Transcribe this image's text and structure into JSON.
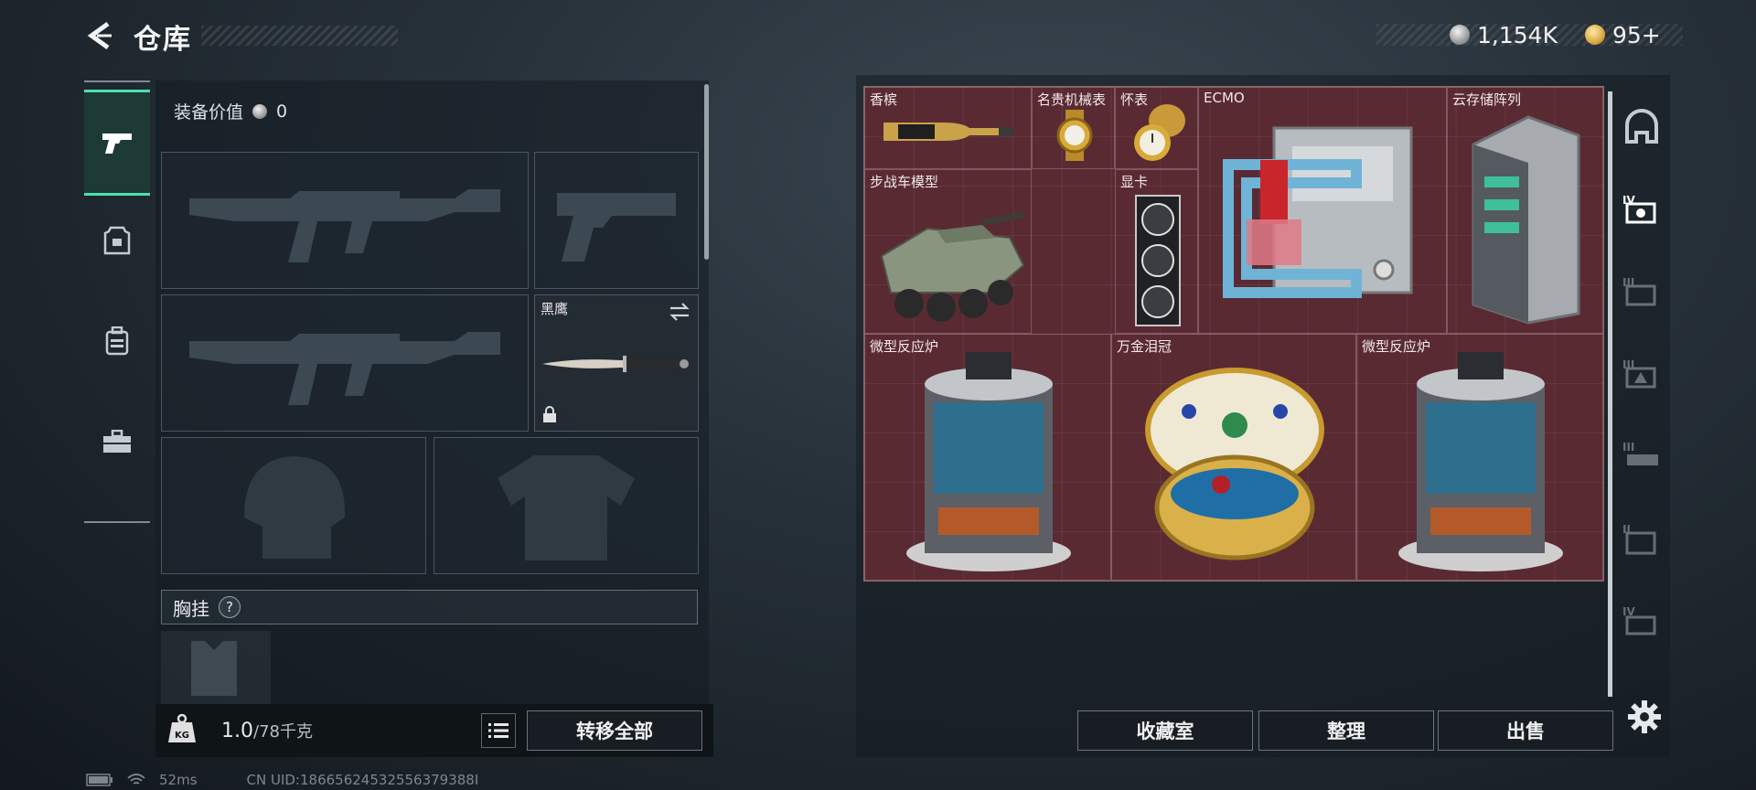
{
  "header": {
    "title": "仓库",
    "currencies": [
      {
        "icon": "silver-coin-icon",
        "value": "1,154K"
      },
      {
        "icon": "gold-coin-icon",
        "value": "95+"
      }
    ]
  },
  "categories": [
    {
      "name": "weapons",
      "icon": "pistol-icon",
      "active": true
    },
    {
      "name": "armor",
      "icon": "armor-vest-icon",
      "active": false
    },
    {
      "name": "backpack",
      "icon": "backpack-icon",
      "active": false
    },
    {
      "name": "toolbox",
      "icon": "toolbox-icon",
      "active": false
    }
  ],
  "equipment": {
    "value_label": "装备价值",
    "value": "0",
    "knife_label": "黑鹰",
    "chest_rig_label": "胸挂",
    "help": "?"
  },
  "footer": {
    "weight_icon_text": "KG",
    "weight_current": "1.0",
    "weight_max": "/78千克",
    "transfer_all": "转移全部"
  },
  "storage": {
    "items": [
      {
        "label": "香槟",
        "icon": "champagne-icon"
      },
      {
        "label": "名贵机械表",
        "icon": "watch-icon"
      },
      {
        "label": "怀表",
        "icon": "pocket-watch-icon"
      },
      {
        "label": "ECMO",
        "icon": "ecmo-machine-icon"
      },
      {
        "label": "云存储阵列",
        "icon": "cloud-storage-array-icon"
      },
      {
        "label": "步战车模型",
        "icon": "ifv-model-icon"
      },
      {
        "label": "显卡",
        "icon": "graphics-card-icon"
      },
      {
        "label": "微型反应炉",
        "icon": "micro-reactor-icon"
      },
      {
        "label": "万金泪冠",
        "icon": "jeweled-egg-icon"
      },
      {
        "label": "微型反应炉",
        "icon": "micro-reactor-icon"
      }
    ],
    "side_tabs": [
      {
        "label": "",
        "icon": "safe-vault-icon"
      },
      {
        "label": "IV",
        "icon": "storage-tier-4-icon"
      },
      {
        "label": "III",
        "icon": "storage-tier-3-icon"
      },
      {
        "label": "III",
        "icon": "storage-tier-3-icon"
      },
      {
        "label": "III",
        "icon": "storage-tier-3-icon"
      },
      {
        "label": "II",
        "icon": "storage-tier-2-icon"
      },
      {
        "label": "IV",
        "icon": "storage-tier-4-icon"
      }
    ],
    "actions": {
      "collection": "收藏室",
      "organize": "整理",
      "sell": "出售"
    }
  },
  "status": {
    "ping": "52ms",
    "uid": "CN UID:18665624532556379388I"
  },
  "colors": {
    "accent": "#4fe0b0",
    "grid_bg": "#5a2a33"
  }
}
